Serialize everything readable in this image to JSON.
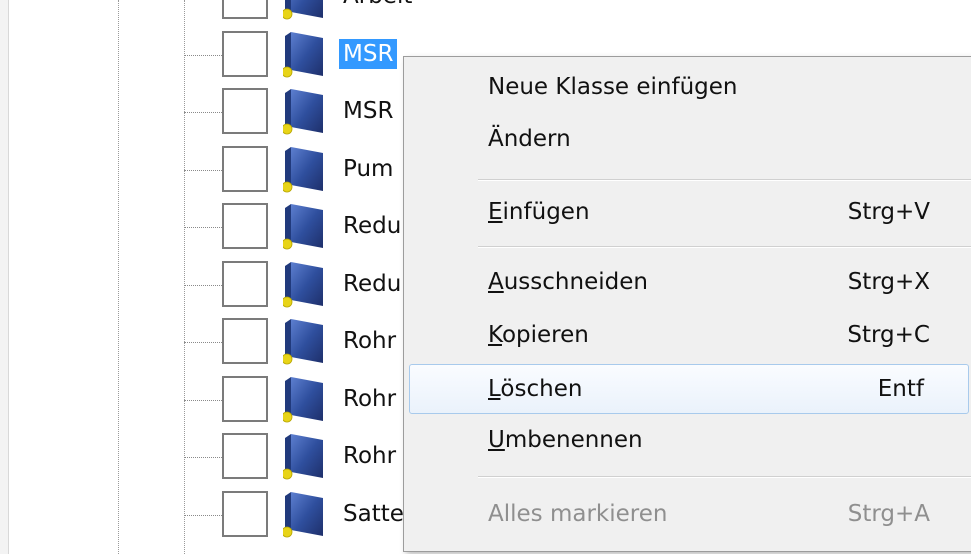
{
  "tree": {
    "rows": [
      {
        "label": "Arbeit",
        "selected": false
      },
      {
        "label": "MSR",
        "selected": true
      },
      {
        "label": "MSR",
        "selected": false
      },
      {
        "label": "Pum",
        "selected": false
      },
      {
        "label": "Redu",
        "selected": false
      },
      {
        "label": "Redu",
        "selected": false
      },
      {
        "label": "Rohr",
        "selected": false
      },
      {
        "label": "Rohr",
        "selected": false
      },
      {
        "label": "Rohr",
        "selected": false
      },
      {
        "label": "Satte",
        "selected": false
      }
    ]
  },
  "context_menu": {
    "new_class": {
      "label": "Neue Klasse einfügen"
    },
    "modify": {
      "label": "Ändern"
    },
    "paste": {
      "label_mnemonic": "E",
      "label_rest": "infügen",
      "shortcut": "Strg+V"
    },
    "cut": {
      "label_mnemonic": "A",
      "label_rest": "usschneiden",
      "shortcut": "Strg+X"
    },
    "copy": {
      "label_mnemonic": "K",
      "label_rest": "opieren",
      "shortcut": "Strg+C"
    },
    "delete": {
      "label_mnemonic": "L",
      "label_rest": "öschen",
      "shortcut": "Entf"
    },
    "rename": {
      "label_mnemonic": "U",
      "label_rest": "mbenennen"
    },
    "select_all": {
      "label": "Alles markieren",
      "shortcut": "Strg+A",
      "disabled": true
    }
  },
  "colors": {
    "selection": "#3399ff",
    "menu_background": "#f0f0f0",
    "hover_border": "#a8caec",
    "icon_blue": "#2f4f9e",
    "icon_dot": "#e8d418"
  }
}
